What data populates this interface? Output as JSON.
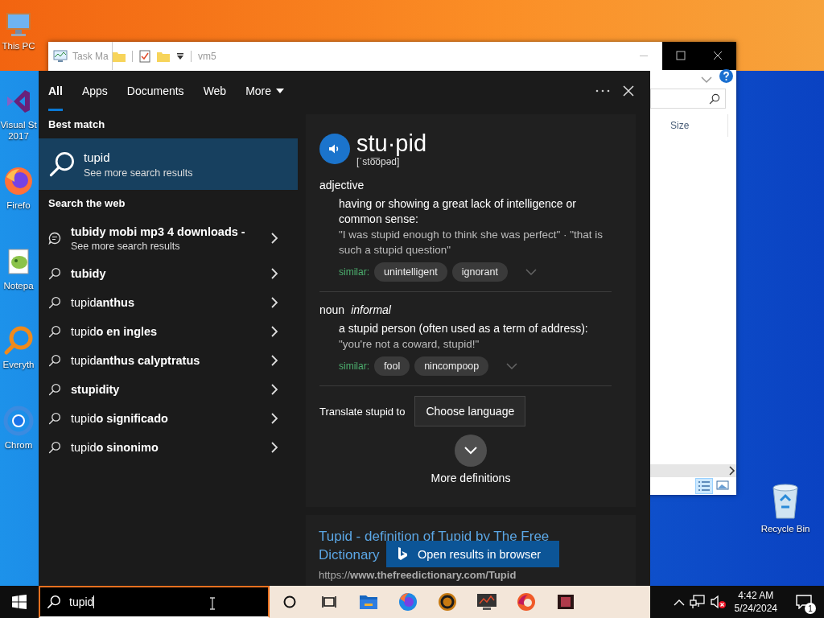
{
  "desktop": {
    "icons": [
      {
        "kind": "pc",
        "label_lines": [
          "This PC"
        ]
      },
      {
        "kind": "studio",
        "label_lines": [
          "Visual St",
          "2017"
        ]
      },
      {
        "kind": "firefox",
        "label_lines": [
          "Firefo"
        ]
      },
      {
        "kind": "notepad",
        "label_lines": [
          "Notepa"
        ]
      },
      {
        "kind": "everything",
        "label_lines": [
          "Everyth"
        ]
      },
      {
        "kind": "chrome",
        "label_lines": [
          "Chrom"
        ]
      }
    ],
    "recycle_bin": {
      "label": "Recycle Bin"
    }
  },
  "task_manager": {
    "title": "Task Ma"
  },
  "explorer": {
    "title": "vm5",
    "columns": [
      "Size"
    ]
  },
  "search": {
    "tabs": [
      {
        "label": "All",
        "selected": true,
        "dropdown": false
      },
      {
        "label": "Apps",
        "selected": false,
        "dropdown": false
      },
      {
        "label": "Documents",
        "selected": false,
        "dropdown": false
      },
      {
        "label": "Web",
        "selected": false,
        "dropdown": false
      },
      {
        "label": "More",
        "selected": false,
        "dropdown": true
      }
    ],
    "best_match": {
      "heading": "Best match",
      "title": "tupid",
      "subtitle": "See more search results",
      "selected": true
    },
    "web": {
      "heading": "Search the web",
      "items": [
        {
          "kind": "chat",
          "text": "**tubidy mobi mp3 4 downloads -**",
          "subtitle": "See more search results"
        },
        {
          "kind": "search",
          "text": "**tubidy**"
        },
        {
          "kind": "search",
          "text": "tupid**anthus**"
        },
        {
          "kind": "search",
          "text": "tupid**o en ingles**"
        },
        {
          "kind": "search",
          "text": "tupid**anthus calyptratus**"
        },
        {
          "kind": "search",
          "text": "**stupidity**"
        },
        {
          "kind": "search",
          "text": "tupid**o significado**"
        },
        {
          "kind": "search",
          "text": "tupid**o sinonimo**"
        }
      ]
    },
    "dictionary": {
      "word": "stu·pid",
      "pronunciation": "[ˈsto͞opəd]",
      "senses": [
        {
          "pos": "adjective",
          "definition": "having or showing a great lack of intelligence or common sense:",
          "examples": "\"I was stupid enough to think she was perfect\" · \"that is such a stupid question\"",
          "similar_label": "similar:",
          "similar": [
            "unintelligent",
            "ignorant"
          ]
        },
        {
          "pos": "noun",
          "register": "informal",
          "definition": "a stupid person (often used as a term of address):",
          "examples": "\"you're not a coward, stupid!\"",
          "similar_label": "similar:",
          "similar": [
            "fool",
            "nincompoop"
          ]
        }
      ],
      "translate_label": "Translate stupid to",
      "translate_button": "Choose language",
      "more": "More definitions"
    },
    "web_result": {
      "title": "Tupid - definition of Tupid by The Free Dictionary",
      "url": "https://**www.thefreedictionary.com/Tupid**"
    },
    "open_button": "Open results in browser"
  },
  "taskbar": {
    "search_value": "tupid",
    "time": "4:42 AM",
    "date": "5/24/2024",
    "notifications": "1"
  }
}
